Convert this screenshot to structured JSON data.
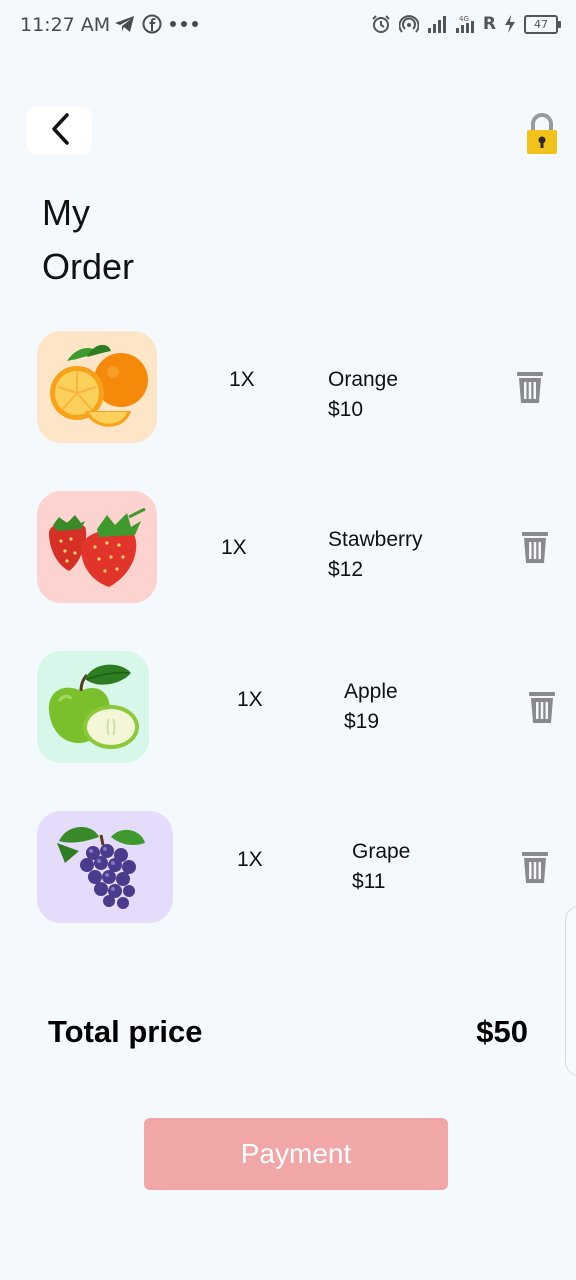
{
  "status_bar": {
    "time": "11:27 AM",
    "left_icons": [
      "telegram-icon",
      "facebook-icon",
      "more-dots-icon"
    ],
    "right_icons": [
      "alarm-icon",
      "hotspot-icon",
      "signal-icon",
      "signal-4g-icon"
    ],
    "roaming": "R",
    "battery": "47"
  },
  "header": {
    "back_icon": "chevron-left-icon",
    "lock_icon": "lock-icon",
    "title": "My\nOrder"
  },
  "items": [
    {
      "qty": "1X",
      "name": "Orange",
      "price": "$10",
      "bg": "#fde6c8"
    },
    {
      "qty": "1X",
      "name": "Stawberry",
      "price": "$12",
      "bg": "#fdd3d0"
    },
    {
      "qty": "1X",
      "name": "Apple",
      "price": "$19",
      "bg": "#d6f7ea"
    },
    {
      "qty": "1X",
      "name": "Grape",
      "price": "$11",
      "bg": "#e5dcfb"
    }
  ],
  "total": {
    "label": "Total price",
    "value": "$50"
  },
  "payment": {
    "label": "Payment",
    "color": "#f1a7a8"
  },
  "colors": {
    "background": "#f4f9fe",
    "trash": "#8a8a8e",
    "lock": "#f2c21b"
  }
}
